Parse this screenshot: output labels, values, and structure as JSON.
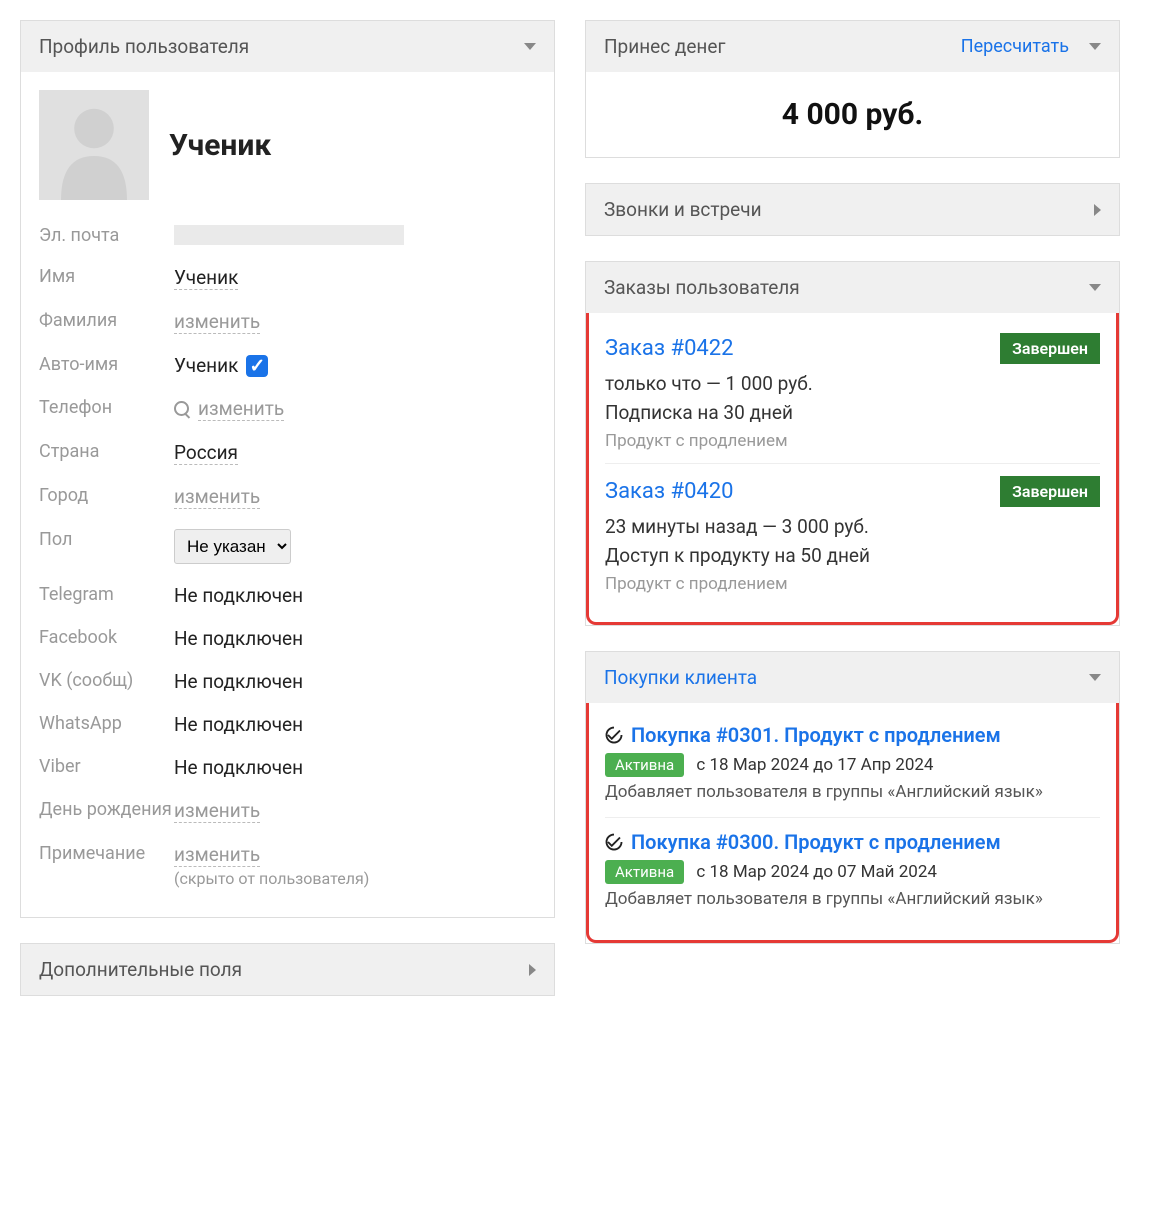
{
  "profile": {
    "panel_title": "Профиль пользователя",
    "user_title": "Ученик",
    "fields": {
      "email_label": "Эл. почта",
      "name_label": "Имя",
      "name_value": "Ученик",
      "surname_label": "Фамилия",
      "surname_value": "изменить",
      "autoname_label": "Авто-имя",
      "autoname_value": "Ученик",
      "phone_label": "Телефон",
      "phone_value": "изменить",
      "country_label": "Страна",
      "country_value": "Россия",
      "city_label": "Город",
      "city_value": "изменить",
      "gender_label": "Пол",
      "gender_value": "Не указан",
      "telegram_label": "Telegram",
      "telegram_value": "Не подключен",
      "facebook_label": "Facebook",
      "facebook_value": "Не подключен",
      "vk_label": "VK (сообщ)",
      "vk_value": "Не подключен",
      "whatsapp_label": "WhatsApp",
      "whatsapp_value": "Не подключен",
      "viber_label": "Viber",
      "viber_value": "Не подключен",
      "birthday_label": "День рождения",
      "birthday_value": "изменить",
      "note_label": "Примечание",
      "note_value": "изменить",
      "note_hint": "(скрыто от пользователя)"
    }
  },
  "additional_fields": {
    "title": "Дополнительные поля"
  },
  "money": {
    "title": "Принес денег",
    "recalc": "Пересчитать",
    "amount": "4 000 руб."
  },
  "calls": {
    "title": "Звонки и встречи"
  },
  "orders": {
    "title": "Заказы пользователя",
    "items": [
      {
        "name": "Заказ #0422",
        "status": "Завершен",
        "line1": "только что — 1 000 руб.",
        "line2": "Подписка на 30 дней",
        "sub": "Продукт с продлением"
      },
      {
        "name": "Заказ #0420",
        "status": "Завершен",
        "line1": "23 минуты назад — 3 000 руб.",
        "line2": "Доступ к продукту на 50 дней",
        "sub": "Продукт с продлением"
      }
    ]
  },
  "purchases": {
    "title": "Покупки клиента",
    "items": [
      {
        "title": "Покупка #0301. Продукт с продлением",
        "status": "Активна",
        "dates": "с 18 Мар 2024 до 17 Апр 2024",
        "desc": "Добавляет пользователя в группы «Английский язык»"
      },
      {
        "title": "Покупка #0300. Продукт с продлением",
        "status": "Активна",
        "dates": "с 18 Мар 2024 до 07 Май 2024",
        "desc": "Добавляет пользователя в группы «Английский язык»"
      }
    ]
  }
}
